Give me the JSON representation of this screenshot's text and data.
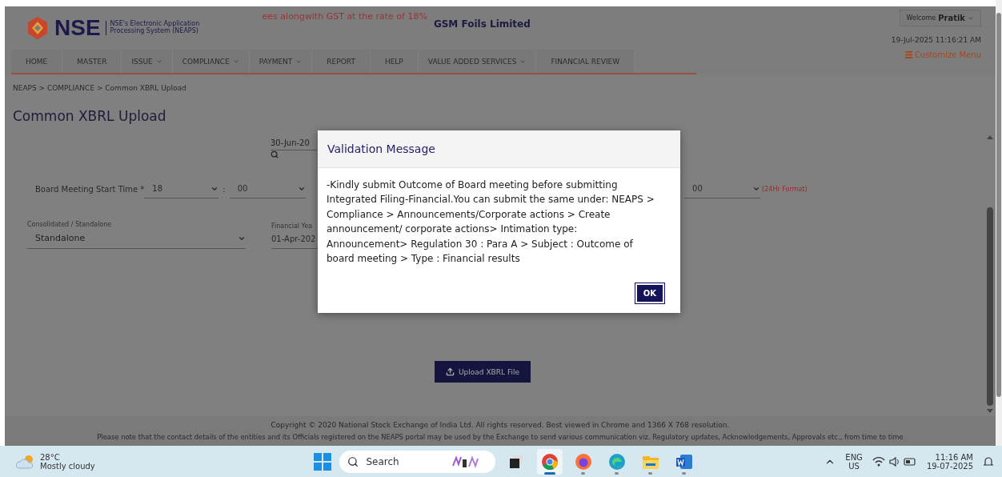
{
  "header": {
    "logo_text": "NSE",
    "logo_subtitle": "NSE's Electronic Application Processing System (NEAPS)",
    "ticker": "ees alongwith GST at the rate of 18%",
    "company": "GSM Foils Limited",
    "welcome_label": "Welcome",
    "user": "Pratik",
    "datetime": "19-Jul-2025 11:16:21 AM",
    "customize_menu": "Customize Menu"
  },
  "nav": [
    {
      "label": "HOME",
      "has_menu": false
    },
    {
      "label": "MASTER",
      "has_menu": false
    },
    {
      "label": "ISSUE",
      "has_menu": true
    },
    {
      "label": "COMPLIANCE",
      "has_menu": true
    },
    {
      "label": "PAYMENT",
      "has_menu": true
    },
    {
      "label": "REPORT",
      "has_menu": false
    },
    {
      "label": "HELP",
      "has_menu": false
    },
    {
      "label": "VALUE ADDED SERVICES",
      "has_menu": true
    },
    {
      "label": "FINANCIAL REVIEW",
      "has_menu": false
    }
  ],
  "breadcrumb": "NEAPS > COMPLIANCE > Common XBRL Upload",
  "page_title": "Common XBRL Upload",
  "form": {
    "date_value": "30-Jun-20",
    "separator": ":",
    "time_label": "Board Meeting Start Time *",
    "start_hour": "18",
    "start_minute": "00",
    "end_minute": "00",
    "time_hint": "(24Hr Format)",
    "type_label": "Consolidated / Standalone",
    "type_value": "Standalone",
    "fy_label": "Financial Yea",
    "fy_value": "01-Apr-202",
    "upload_button": "Upload XBRL File"
  },
  "footer": {
    "copyright": "Copyright © 2020 National Stock Exchange of India Ltd. All rights reserved. Best viewed in Chrome and 1366 X 768 resolution.",
    "notice": "Please note that the contact details of the entities and its Officials registered on the NEAPS portal may be used by the Exchange to send various communication viz. Regulatory updates, Acknowledgements, Approvals etc., from time to time"
  },
  "modal": {
    "title": "Validation Message",
    "message": "-Kindly submit Outcome of Board meeting before submitting Integrated Filing-Financial.You can submit the same under: NEAPS > Compliance > Announcements/Corporate actions > Create announcement/ corporate actions> Intimation type: Announcement> Regulation 30 : Para A > Subject : Outcome of board meeting > Type : Financial results",
    "ok": "OK"
  },
  "taskbar": {
    "temperature": "28°C",
    "weather": "Mostly cloudy",
    "search_placeholder": "Search",
    "apps": [
      {
        "kind": "taskview",
        "running": false,
        "selected": false
      },
      {
        "kind": "chrome",
        "running": true,
        "selected": true
      },
      {
        "kind": "firefox",
        "running": true,
        "selected": false
      },
      {
        "kind": "edge",
        "running": true,
        "selected": false
      },
      {
        "kind": "explorer",
        "running": true,
        "selected": false
      },
      {
        "kind": "word",
        "running": true,
        "selected": false
      }
    ],
    "language": "ENG",
    "region": "US",
    "time": "11:16 AM",
    "date": "19-07-2025"
  }
}
